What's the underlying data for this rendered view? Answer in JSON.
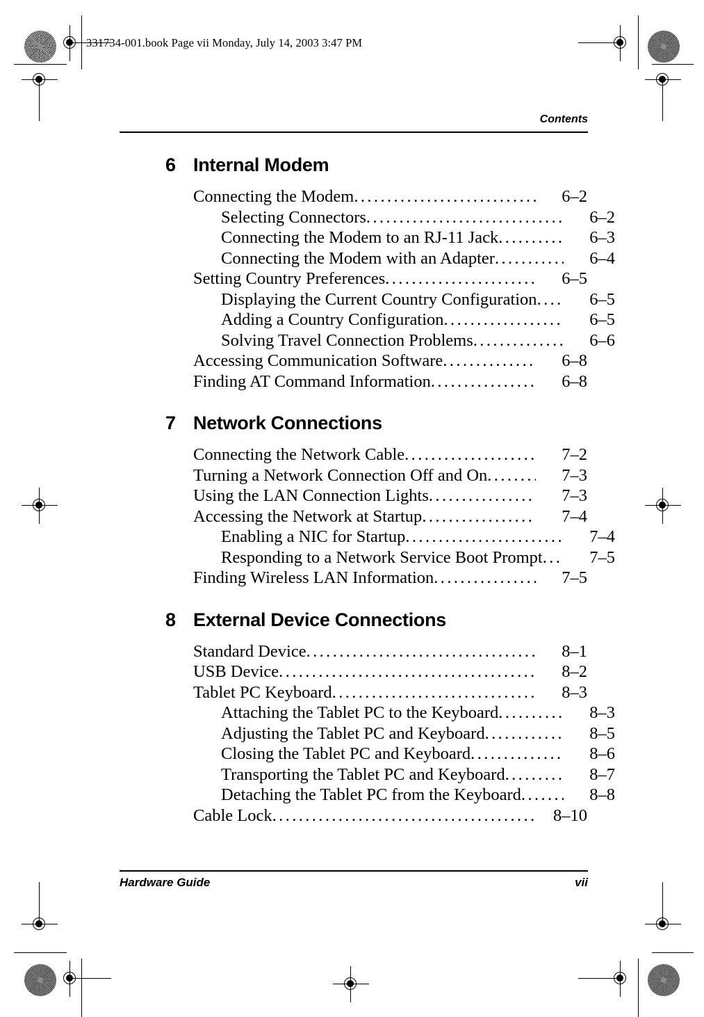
{
  "print_stamp": "331734-001.book  Page vii  Monday, July 14, 2003  3:47 PM",
  "running_head": "Contents",
  "footer": {
    "left": "Hardware Guide",
    "right": "vii"
  },
  "chapters": [
    {
      "number": "6",
      "title": "Internal Modem",
      "entries": [
        {
          "level": 1,
          "label": "Connecting the Modem",
          "page": "6–2"
        },
        {
          "level": 2,
          "label": "Selecting Connectors",
          "page": "6–2"
        },
        {
          "level": 2,
          "label": "Connecting the Modem to an RJ-11 Jack",
          "page": "6–3"
        },
        {
          "level": 2,
          "label": "Connecting the Modem with an Adapter",
          "page": "6–4"
        },
        {
          "level": 1,
          "label": "Setting Country Preferences",
          "page": "6–5"
        },
        {
          "level": 2,
          "label": "Displaying the Current Country Configuration",
          "page": "6–5"
        },
        {
          "level": 2,
          "label": "Adding a Country Configuration",
          "page": "6–5"
        },
        {
          "level": 2,
          "label": "Solving Travel Connection Problems",
          "page": "6–6"
        },
        {
          "level": 1,
          "label": "Accessing Communication Software",
          "page": "6–8"
        },
        {
          "level": 1,
          "label": "Finding AT Command Information",
          "page": "6–8"
        }
      ]
    },
    {
      "number": "7",
      "title": "Network Connections",
      "entries": [
        {
          "level": 1,
          "label": "Connecting the Network Cable",
          "page": "7–2"
        },
        {
          "level": 1,
          "label": "Turning a Network Connection Off and On",
          "page": "7–3"
        },
        {
          "level": 1,
          "label": "Using the LAN Connection Lights",
          "page": "7–3"
        },
        {
          "level": 1,
          "label": "Accessing the Network at Startup",
          "page": "7–4"
        },
        {
          "level": 2,
          "label": "Enabling a NIC for Startup",
          "page": "7–4"
        },
        {
          "level": 2,
          "label": "Responding to a Network Service Boot Prompt",
          "page": "7–5"
        },
        {
          "level": 1,
          "label": "Finding Wireless LAN Information",
          "page": "7–5"
        }
      ]
    },
    {
      "number": "8",
      "title": "External Device Connections",
      "entries": [
        {
          "level": 1,
          "label": "Standard Device",
          "page": "8–1"
        },
        {
          "level": 1,
          "label": "USB Device",
          "page": "8–2"
        },
        {
          "level": 1,
          "label": "Tablet PC Keyboard",
          "page": "8–3"
        },
        {
          "level": 2,
          "label": "Attaching the Tablet PC to the Keyboard",
          "page": "8–3"
        },
        {
          "level": 2,
          "label": "Adjusting the Tablet PC and Keyboard",
          "page": "8–5"
        },
        {
          "level": 2,
          "label": "Closing the Tablet PC and Keyboard",
          "page": "8–6"
        },
        {
          "level": 2,
          "label": "Transporting the Tablet PC and Keyboard",
          "page": "8–7"
        },
        {
          "level": 2,
          "label": "Detaching the Tablet PC from the Keyboard",
          "page": "8–8"
        },
        {
          "level": 1,
          "label": "Cable Lock",
          "page": "8–10"
        }
      ]
    }
  ]
}
